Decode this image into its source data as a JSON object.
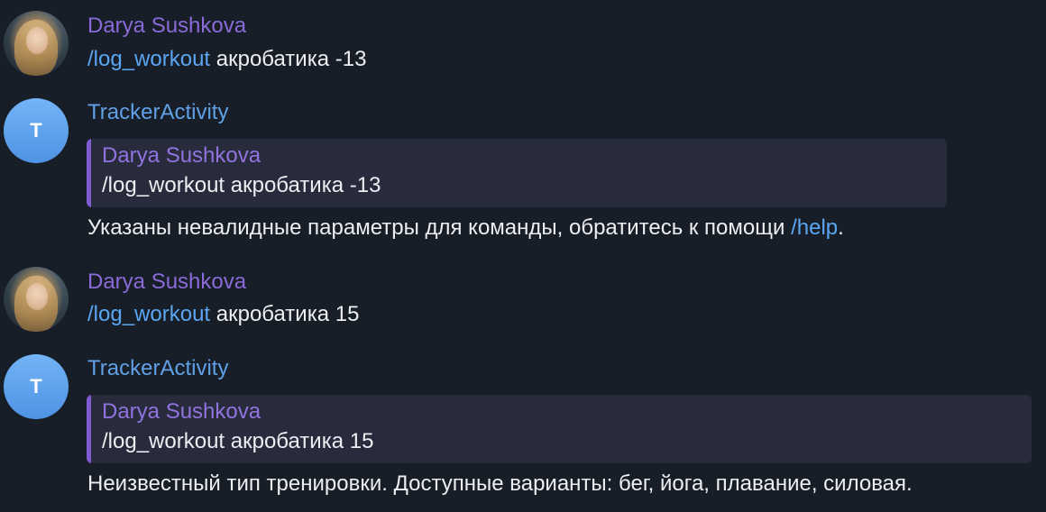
{
  "messages": [
    {
      "sender": "Darya Sushkova",
      "command": "/log_workout",
      "args": " акробатика -13"
    },
    {
      "sender": "TrackerActivity",
      "avatar_letter": "T",
      "reply": {
        "sender": "Darya Sushkova",
        "text": "/log_workout акробатика -13"
      },
      "text_before": "Указаны невалидные параметры для команды, обратитесь к помощи ",
      "link": "/help",
      "text_after": "."
    },
    {
      "sender": "Darya Sushkova",
      "command": "/log_workout",
      "args": " акробатика 15"
    },
    {
      "sender": "TrackerActivity",
      "avatar_letter": "T",
      "reply": {
        "sender": "Darya Sushkova",
        "text": "/log_workout акробатика 15"
      },
      "text": "Неизвестный тип тренировки. Доступные варианты: бег, йога, плавание, силовая."
    }
  ],
  "colors": {
    "background": "#181e27",
    "user_name": "#8a6ad8",
    "bot_name": "#5fa0e6",
    "link": "#5aa6f2",
    "reply_background": "#272b3b",
    "reply_bar": "#7e5bd0"
  }
}
